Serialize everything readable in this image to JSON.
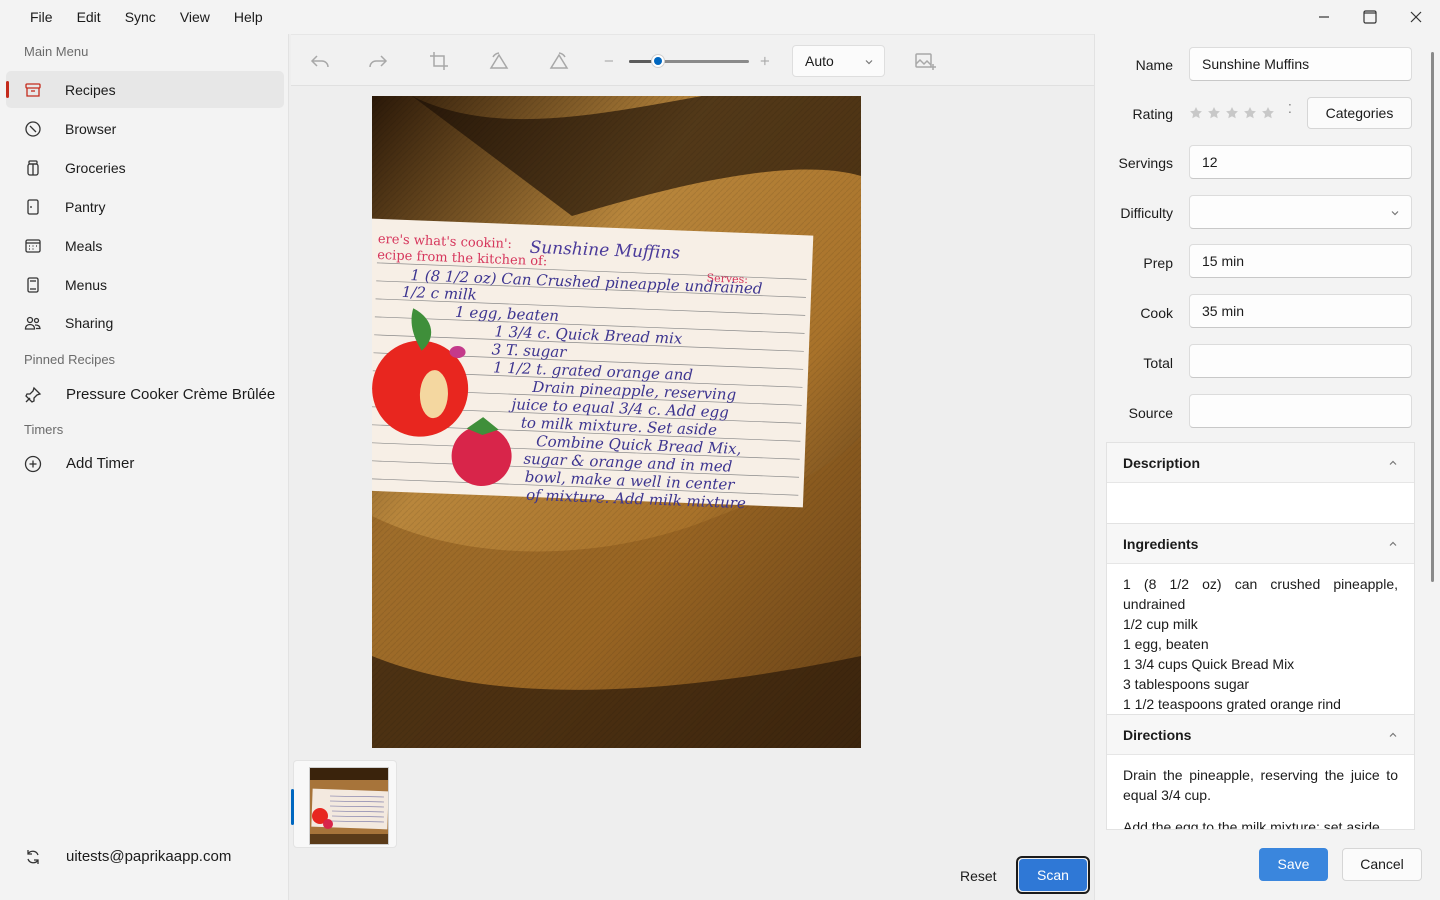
{
  "menubar": {
    "items": [
      "File",
      "Edit",
      "Sync",
      "View",
      "Help"
    ]
  },
  "window_controls": {
    "minimize": "minimize-icon",
    "maximize": "maximize-icon",
    "close": "close-icon"
  },
  "sidebar": {
    "main_menu_title": "Main Menu",
    "items": [
      {
        "label": "Recipes",
        "icon": "recipes-box-icon",
        "active": true
      },
      {
        "label": "Browser",
        "icon": "compass-icon"
      },
      {
        "label": "Groceries",
        "icon": "jar-icon"
      },
      {
        "label": "Pantry",
        "icon": "pantry-door-icon"
      },
      {
        "label": "Meals",
        "icon": "calendar-icon"
      },
      {
        "label": "Menus",
        "icon": "menu-card-icon"
      },
      {
        "label": "Sharing",
        "icon": "people-icon"
      }
    ],
    "pinned_title": "Pinned Recipes",
    "pinned": [
      {
        "label": "Pressure Cooker Crème Brûlée",
        "icon": "pin-icon"
      }
    ],
    "timers_title": "Timers",
    "add_timer": "Add Timer",
    "account": "uitests@paprikaapp.com"
  },
  "editor": {
    "zoom_mode": "Auto",
    "zoom_fraction": 0.24,
    "reset_label": "Reset",
    "scan_label": "Scan"
  },
  "card": {
    "header1": "ere's what's cookin':",
    "header2": "ecipe from the kitchen of:",
    "title": "Sunshine Muffins",
    "serves": "Serves:",
    "lines": [
      "1 (8 1/2 oz) Can Crushed pineapple undrained",
      "1/2 c milk",
      "1 egg, beaten",
      "1 3/4 c. Quick Bread mix",
      "3 T. sugar",
      "1 1/2 t. grated orange and",
      "Drain pineapple, reserving",
      "juice to equal 3/4 c. Add egg",
      "to milk mixture. Set aside",
      "Combine Quick Bread Mix,",
      "sugar & orange and in med",
      "bowl, make a well in center",
      "of mixture. Add milk mixture"
    ]
  },
  "form": {
    "name_label": "Name",
    "name_value": "Sunshine Muffins",
    "rating_label": "Rating",
    "rating_value": 0,
    "categories_label": "Categories",
    "servings_label": "Servings",
    "servings_value": "12",
    "difficulty_label": "Difficulty",
    "difficulty_value": "",
    "prep_label": "Prep",
    "prep_value": "15 min",
    "cook_label": "Cook",
    "cook_value": "35 min",
    "total_label": "Total",
    "total_value": "",
    "source_label": "Source",
    "source_value": "",
    "description_title": "Description",
    "description_value": "",
    "ingredients_title": "Ingredients",
    "ingredients": [
      "1 (8 1/2 oz) can crushed pineapple, undrained",
      "1/2 cup milk",
      "1 egg, beaten",
      "1 3/4 cups Quick Bread Mix",
      "3 tablespoons sugar",
      "1 1/2 teaspoons grated orange rind"
    ],
    "directions_title": "Directions",
    "directions": "Drain the pineapple, reserving the juice to equal 3/4 cup.",
    "directions_next": "Add the egg to the milk mixture; set aside.",
    "save_label": "Save",
    "cancel_label": "Cancel"
  },
  "colors": {
    "accent": "#0067c0",
    "recipes_red": "#c42b1c",
    "save_blue": "#3a86dd"
  }
}
